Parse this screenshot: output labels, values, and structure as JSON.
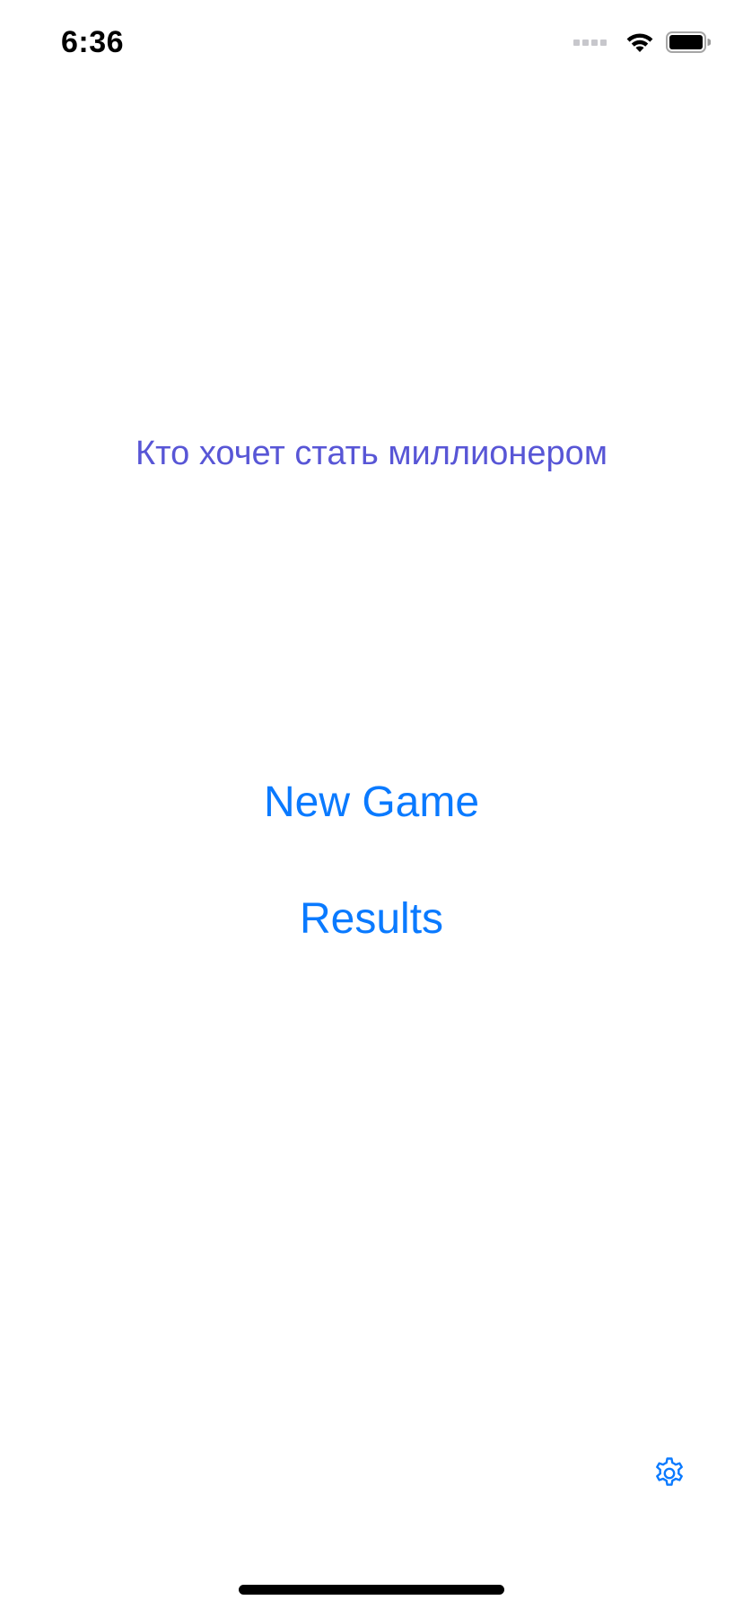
{
  "status_bar": {
    "time": "6:36"
  },
  "main": {
    "title": "Кто хочет стать миллионером",
    "new_game_label": "New Game",
    "results_label": "Results"
  },
  "icons": {
    "signal": "cellular-signal-icon",
    "wifi": "wifi-icon",
    "battery": "battery-icon",
    "settings": "gear-icon"
  },
  "colors": {
    "title": "#5856d6",
    "accent": "#0a7aff",
    "background": "#ffffff"
  }
}
